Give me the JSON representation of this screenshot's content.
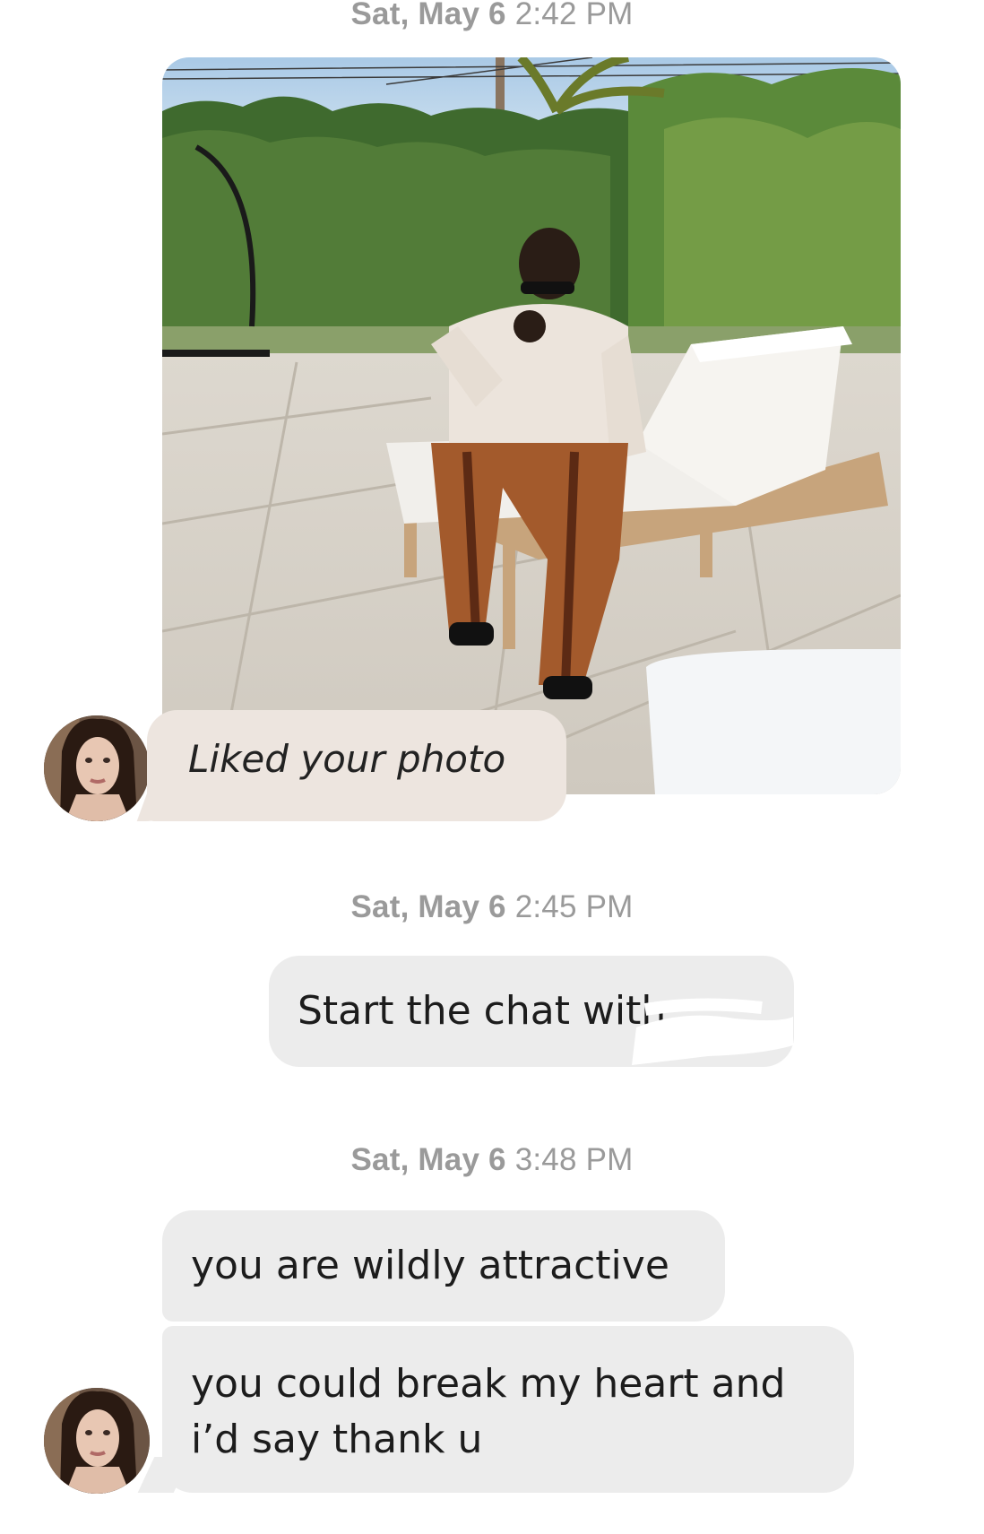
{
  "timestamps": [
    {
      "day": "Sat, May 6",
      "time": "2:42 PM"
    },
    {
      "day": "Sat, May 6",
      "time": "2:45 PM"
    },
    {
      "day": "Sat, May 6",
      "time": "3:48 PM"
    }
  ],
  "photo_card": {
    "liked_label": "Liked your photo"
  },
  "system_message": {
    "text": "Start the chat with"
  },
  "messages": [
    {
      "text": "you are wildly attractive"
    },
    {
      "line1": "you could break my heart and",
      "line2": "i’d say thank u"
    }
  ],
  "colors": {
    "liked_bubble": "#ede5df",
    "gray_bubble": "#ececec",
    "timestamp": "#9a9a9a"
  }
}
